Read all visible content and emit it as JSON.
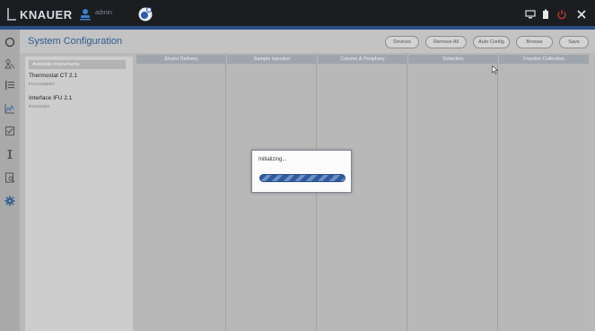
{
  "topbar": {
    "brand": "KNAUER",
    "user": "admin",
    "icons": [
      "knauer-logo-icon",
      "user-icon",
      "gear-bubble-icon",
      "network-icon",
      "battery-icon",
      "power-icon",
      "close-icon"
    ],
    "accent_color": "#2a4f82"
  },
  "rail": {
    "icons": [
      "home-icon",
      "instruments-icon",
      "method-icon",
      "chart-icon",
      "checklist-icon",
      "info-icon",
      "search-doc-icon",
      "settings-icon"
    ]
  },
  "header": {
    "title": "System Configuration",
    "buttons": [
      "Devices",
      "Remove All",
      "Auto Config",
      "Browse",
      "Save"
    ]
  },
  "instruments": {
    "header": "Available Instruments",
    "items": [
      {
        "name": "Thermostat CT 2.1",
        "serial": "FCC21185007"
      },
      {
        "name": "Interface IFU 2.1",
        "serial": "IFU0U1093"
      }
    ]
  },
  "columns": [
    "Eluent Delivery",
    "Sample Injection",
    "Column & Periphery",
    "Detection",
    "Fraction Collection"
  ],
  "dialog": {
    "message": "Initializing...",
    "progress_color": "#2f5aa0"
  }
}
